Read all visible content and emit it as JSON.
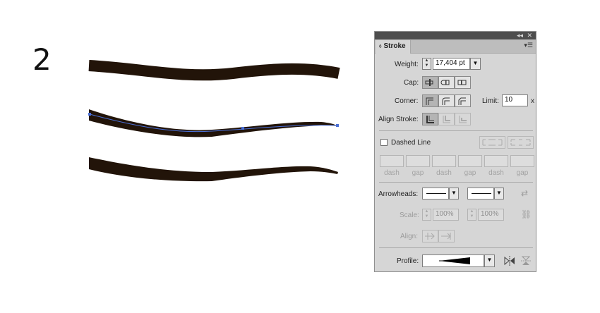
{
  "artboard": {
    "step_number": "2",
    "stroke_color": "#221409",
    "path_color": "#4a6fd6"
  },
  "panel": {
    "title": "Stroke",
    "weight": {
      "label": "Weight:",
      "value": "17,404 pt"
    },
    "cap": {
      "label": "Cap:",
      "selected": 0
    },
    "corner": {
      "label": "Corner:",
      "selected": 0
    },
    "limit": {
      "label": "Limit:",
      "value": "10",
      "suffix": "x"
    },
    "align_stroke": {
      "label": "Align Stroke:",
      "selected": 0
    },
    "dashed": {
      "label": "Dashed Line",
      "checked": false,
      "fields": [
        "dash",
        "gap",
        "dash",
        "gap",
        "dash",
        "gap"
      ]
    },
    "arrowheads": {
      "label": "Arrowheads:"
    },
    "scale": {
      "label": "Scale:",
      "start": "100%",
      "end": "100%"
    },
    "align": {
      "label": "Align:"
    },
    "profile": {
      "label": "Profile:"
    }
  }
}
